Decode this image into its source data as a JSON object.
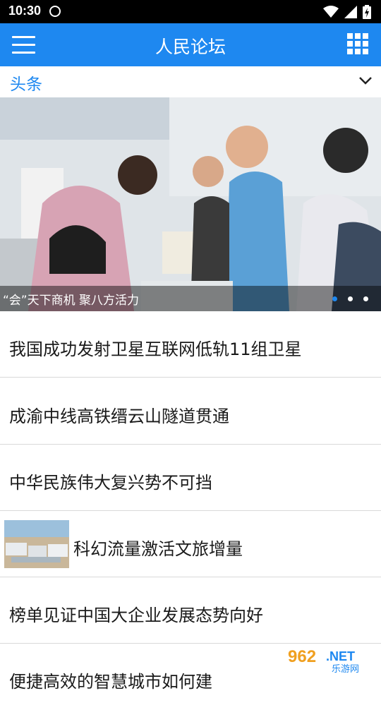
{
  "status_bar": {
    "time": "10:30"
  },
  "app_bar": {
    "title": "人民论坛",
    "menu_icon": "hamburger-menu-icon",
    "grid_icon": "grid-apps-icon",
    "color": "#1e88f0"
  },
  "channel": {
    "label": "头条",
    "chevron_icon": "chevron-down-icon"
  },
  "carousel": {
    "caption": "“会”天下商机 聚八方活力",
    "total_slides": 3,
    "active_slide": 1
  },
  "news": [
    {
      "title": "我国成功发射卫星互联网低轨11组卫星",
      "has_thumbnail": false
    },
    {
      "title": "成渝中线高铁缙云山隧道贯通",
      "has_thumbnail": false
    },
    {
      "title": "中华民族伟大复兴势不可挡",
      "has_thumbnail": false
    },
    {
      "title": "科幻流量激活文旅增量",
      "has_thumbnail": true
    },
    {
      "title": "榜单见证中国大企业发展态势向好",
      "has_thumbnail": false
    },
    {
      "title": "便捷高效的智慧城市如何建",
      "has_thumbnail": false
    }
  ],
  "watermark": {
    "brand_number": "962",
    "brand_suffix": ".NET",
    "brand_name": "乐游网"
  }
}
